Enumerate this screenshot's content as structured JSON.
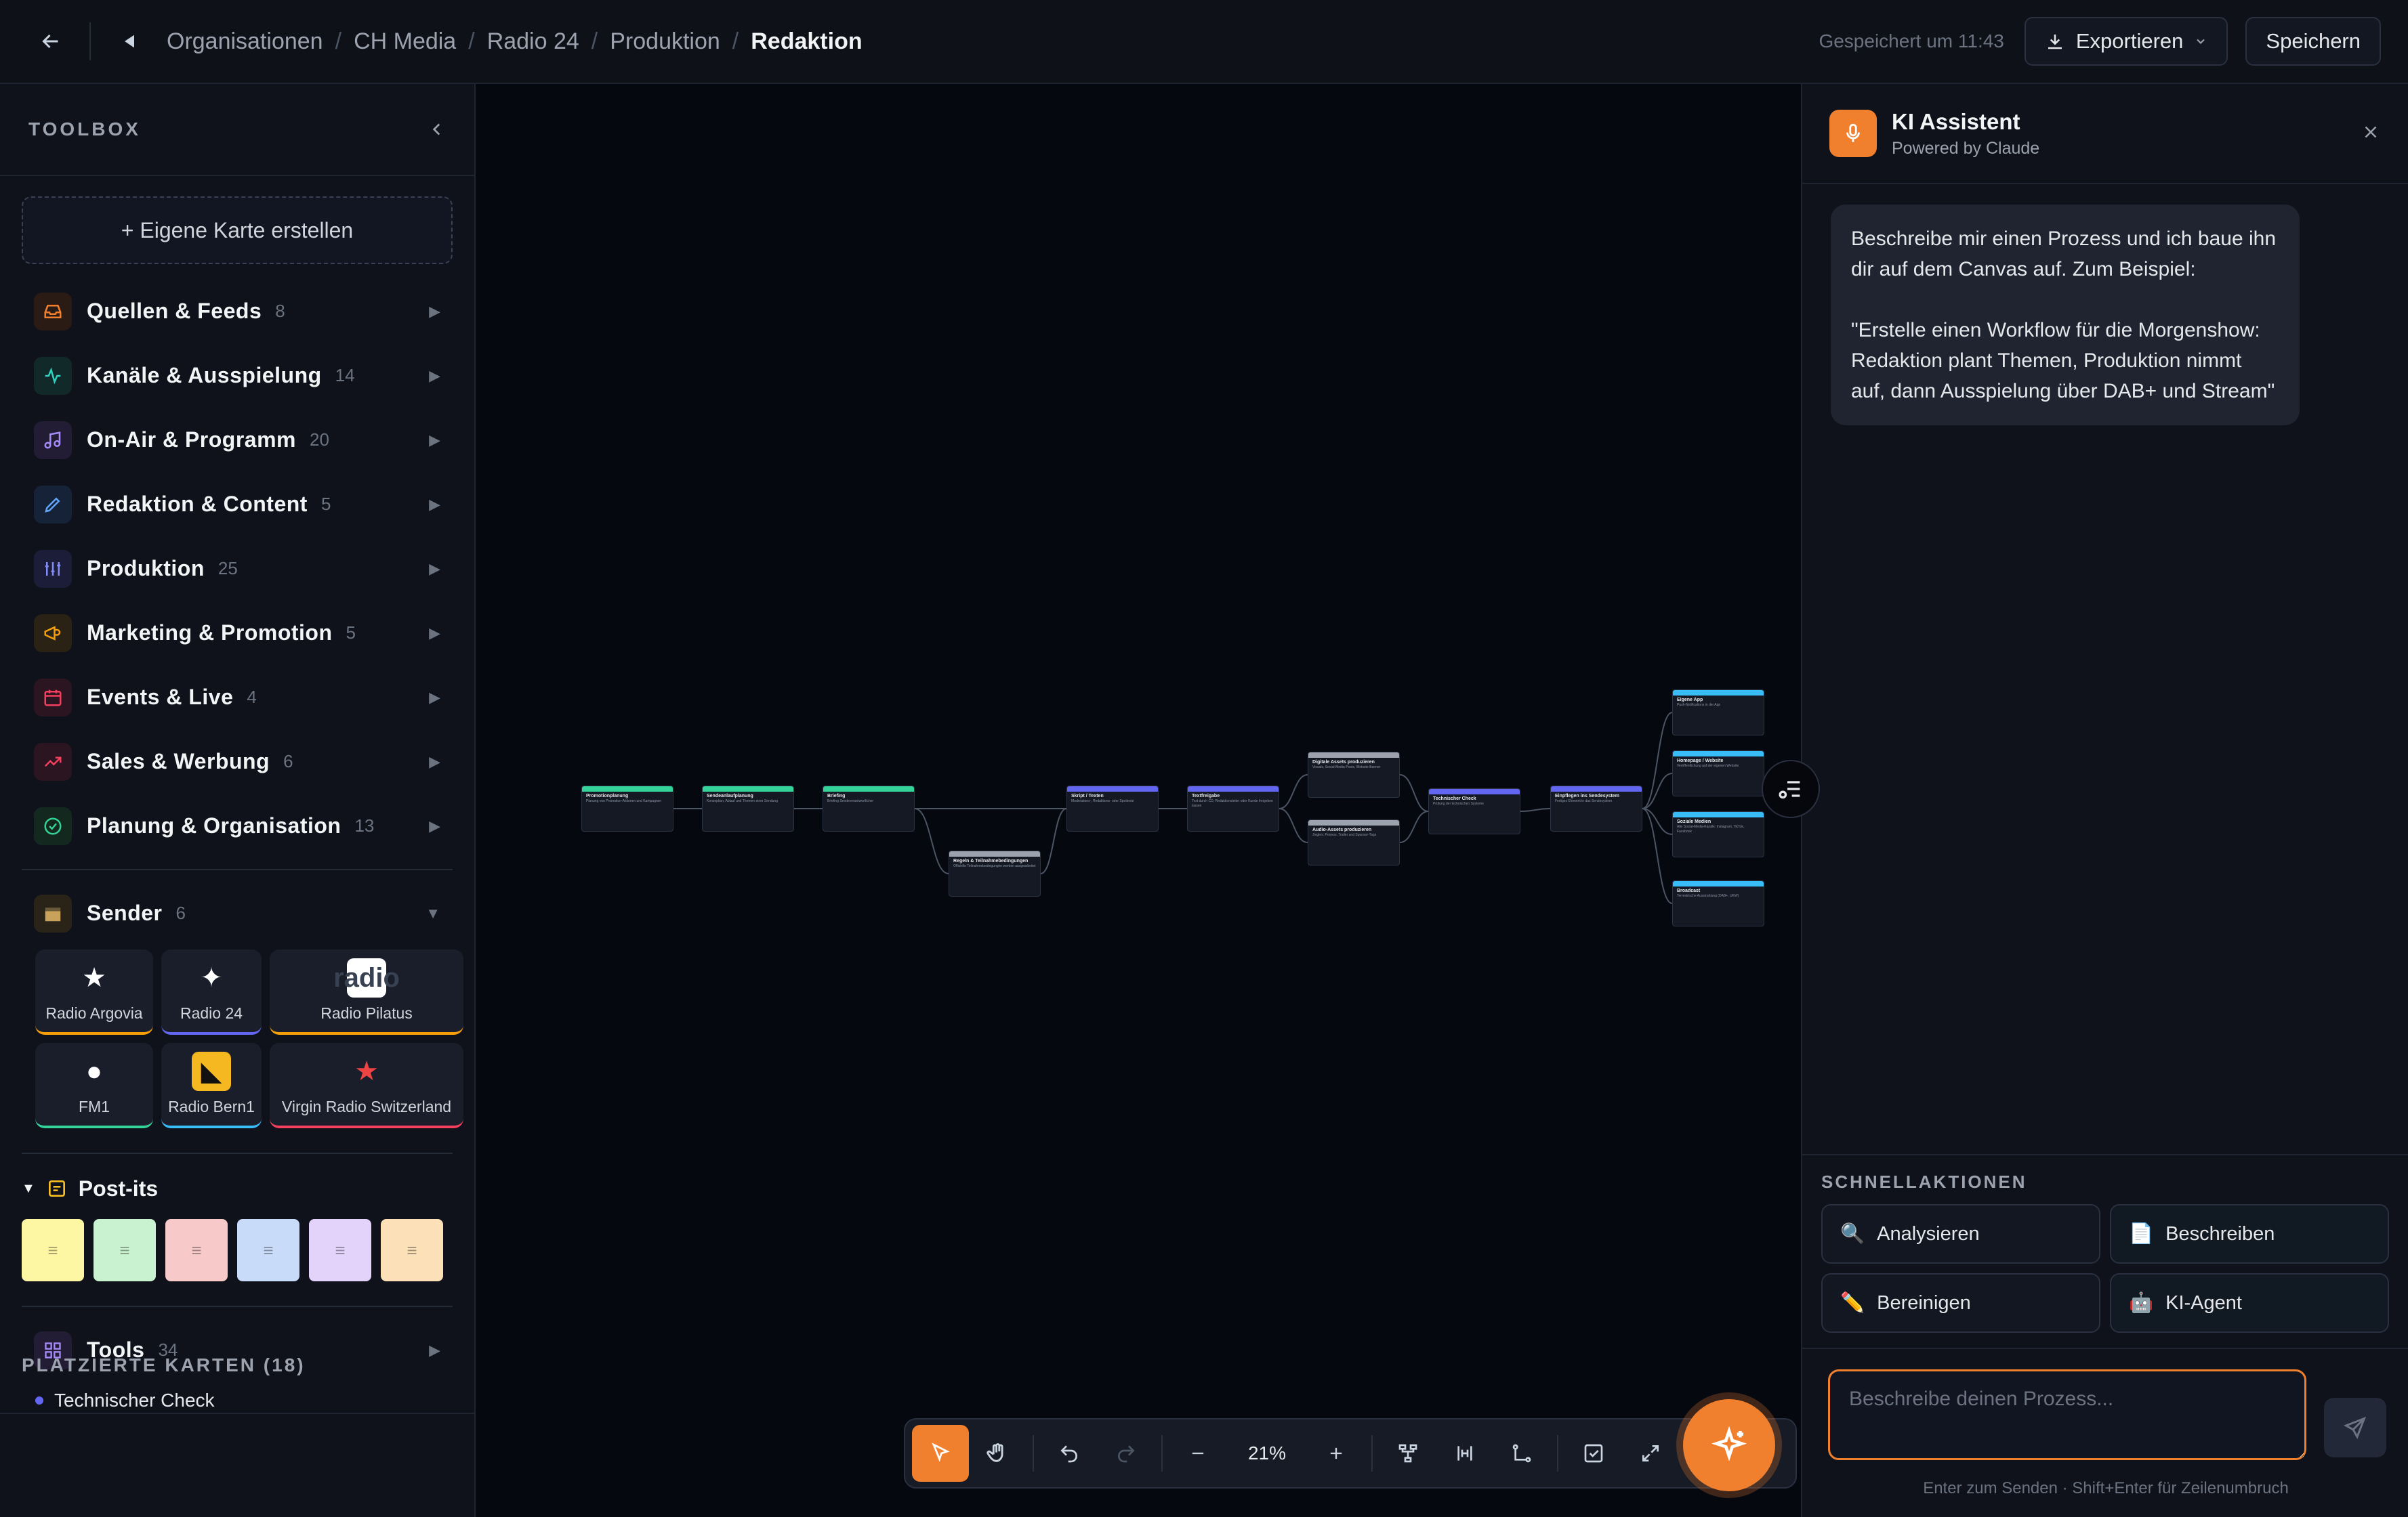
{
  "topbar": {
    "breadcrumbs": [
      "Organisationen",
      "CH Media",
      "Radio 24",
      "Produktion"
    ],
    "current": "Redaktion",
    "saved_text": "Gespeichert um 11:43",
    "export_label": "Exportieren",
    "save_label": "Speichern"
  },
  "toolbox": {
    "title": "TOOLBOX",
    "create_label": "+ Eigene Karte erstellen",
    "categories": [
      {
        "label": "Quellen & Feeds",
        "count": "8",
        "color": "#f07f2e"
      },
      {
        "label": "Kanäle & Ausspielung",
        "count": "14",
        "color": "#2dd4bf"
      },
      {
        "label": "On-Air & Programm",
        "count": "20",
        "color": "#a78bfa"
      },
      {
        "label": "Redaktion & Content",
        "count": "5",
        "color": "#60a5fa"
      },
      {
        "label": "Produktion",
        "count": "25",
        "color": "#818cf8"
      },
      {
        "label": "Marketing & Promotion",
        "count": "5",
        "color": "#f59e0b"
      },
      {
        "label": "Events & Live",
        "count": "4",
        "color": "#f43f5e"
      },
      {
        "label": "Sales & Werbung",
        "count": "6",
        "color": "#f43f5e"
      },
      {
        "label": "Planung & Organisation",
        "count": "13",
        "color": "#34d399"
      }
    ],
    "sender": {
      "label": "Sender",
      "count": "6",
      "stations": [
        {
          "name": "Radio Argovia",
          "accent": "#f59e0b"
        },
        {
          "name": "Radio 24",
          "accent": "#6366f1"
        },
        {
          "name": "Radio Pilatus",
          "accent": "#f59e0b",
          "logo_text": "radio"
        },
        {
          "name": "FM1",
          "accent": "#34d399"
        },
        {
          "name": "Radio Bern1",
          "accent": "#38bdf8"
        },
        {
          "name": "Virgin Radio Switzerland",
          "accent": "#f43f5e"
        }
      ]
    },
    "postits_label": "Post-its",
    "postit_colors": [
      "#fdf6a3",
      "#c9f2d0",
      "#f8c9c9",
      "#c8dcfa",
      "#e3d3fa",
      "#fbe0b8"
    ],
    "tools": {
      "label": "Tools",
      "count": "34"
    }
  },
  "placed": {
    "title": "PLATZIERTE KARTEN (18)",
    "items": [
      "Technischer Check"
    ]
  },
  "canvas": {
    "zoom": "21%",
    "nodes": [
      {
        "title": "Promotionplanung",
        "body": "Planung von Promotion-Aktionen und Kampagnen",
        "color": "#34d399"
      },
      {
        "title": "Sendeanlaufplanung",
        "body": "Konzeption, Ablauf und Themen einer Sendung",
        "color": "#34d399"
      },
      {
        "title": "Briefing",
        "body": "Briefing Sendeverantwortlicher",
        "color": "#34d399"
      },
      {
        "title": "Regeln & Teilnahmebedingungen",
        "body": "Offizielle Teilnahmebedingungen werden ausgearbeitet",
        "color": "#9ca3af"
      },
      {
        "title": "Skript / Texten",
        "body": "Moderations-, Redaktions- oder Spottexte",
        "color": "#6366f1"
      },
      {
        "title": "Textfreigabe",
        "body": "Text durch CD, Redaktionsleiter oder Kunde freigeben lassen",
        "color": "#6366f1"
      },
      {
        "title": "Digitale Assets produzieren",
        "body": "Visuals, Social-Media-Posts, Website-Banner",
        "color": "#9ca3af"
      },
      {
        "title": "Audio-Assets produzieren",
        "body": "Jingles, Promos, Trailer und Sponsor-Tags",
        "color": "#9ca3af"
      },
      {
        "title": "Technischer Check",
        "body": "Prüfung der technischen Systeme",
        "color": "#6366f1"
      },
      {
        "title": "Einpflegen ins Sendesystem",
        "body": "Fertiges Element in das Sendesystem",
        "color": "#6366f1"
      },
      {
        "title": "Eigene App",
        "body": "Push-Notifications in der App",
        "color": "#38bdf8"
      },
      {
        "title": "Homepage / Website",
        "body": "Veröffentlichung auf der eigenen Website",
        "color": "#38bdf8"
      },
      {
        "title": "Soziale Medien",
        "body": "Alle Social-Media-Kanäle: Instagram, TikTok, Facebook",
        "color": "#38bdf8"
      },
      {
        "title": "Broadcast",
        "body": "Terrestrische Ausstrahlung (DAB+, UKW)",
        "color": "#38bdf8"
      }
    ]
  },
  "assistant": {
    "title": "KI Assistent",
    "subtitle": "Powered by Claude",
    "message": "Beschreibe mir einen Prozess und ich baue ihn dir auf dem Canvas auf. Zum Beispiel:\n\n\"Erstelle einen Workflow für die Morgenshow: Redaktion plant Themen, Produktion nimmt auf, dann Ausspielung über DAB+ und Stream\"",
    "quick_title": "SCHNELLAKTIONEN",
    "quick_actions": [
      {
        "label": "Analysieren",
        "icon": "🔍"
      },
      {
        "label": "Beschreiben",
        "icon": "📄"
      },
      {
        "label": "Bereinigen",
        "icon": "✏️"
      },
      {
        "label": "KI-Agent",
        "icon": "🤖"
      }
    ],
    "input_placeholder": "Beschreibe deinen Prozess...",
    "hint": "Enter zum Senden · Shift+Enter für Zeilenumbruch"
  }
}
